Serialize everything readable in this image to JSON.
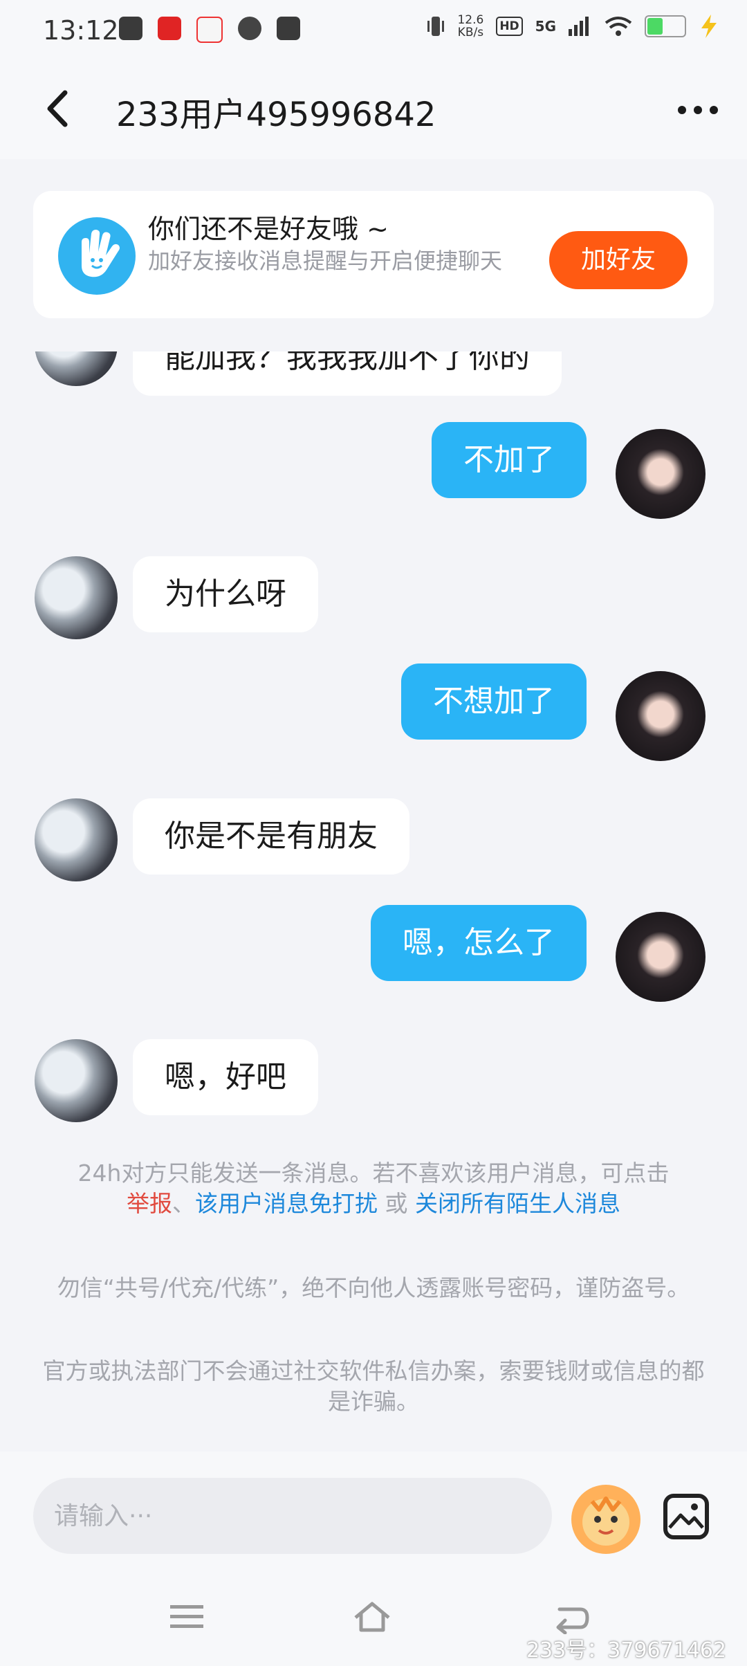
{
  "status_bar": {
    "time": "13:12",
    "net_speed_value": "12.6",
    "net_speed_unit": "KB/s",
    "network": "5G",
    "hd": "HD"
  },
  "header": {
    "title": "233用户495996842"
  },
  "friend_banner": {
    "title": "你们还不是好友哦 ~",
    "subtitle": "加好友接收消息提醒与开启便捷聊天",
    "button": "加好友"
  },
  "messages": [
    {
      "from": "other",
      "text": "能加我？我我我加不了你的"
    },
    {
      "from": "self",
      "text": "不加了"
    },
    {
      "from": "other",
      "text": "为什么呀"
    },
    {
      "from": "self",
      "text": "不想加了"
    },
    {
      "from": "other",
      "text": "你是不是有朋友"
    },
    {
      "from": "self",
      "text": "嗯，怎么了"
    },
    {
      "from": "other",
      "text": "嗯，好吧"
    }
  ],
  "notices": {
    "limit_text": "24h对方只能发送一条消息。若不喜欢该用户消息，可点击",
    "report": "举报",
    "sep": "、",
    "mute_user": "该用户消息免打扰",
    "or": " 或 ",
    "close_strangers": "关闭所有陌生人消息",
    "warning_1": "勿信“共号/代充/代练”，绝不向他人透露账号密码，谨防盗号。",
    "warning_2": "官方或执法部门不会通过社交软件私信办案，索要钱财或信息的都是诈骗。"
  },
  "input": {
    "placeholder": "请输入···"
  },
  "watermark": "233号：379671462",
  "colors": {
    "accent_blue": "#2ab4f6",
    "add_friend_orange": "#ff5a12",
    "report_red": "#e14a3f",
    "link_blue": "#1d88db"
  }
}
